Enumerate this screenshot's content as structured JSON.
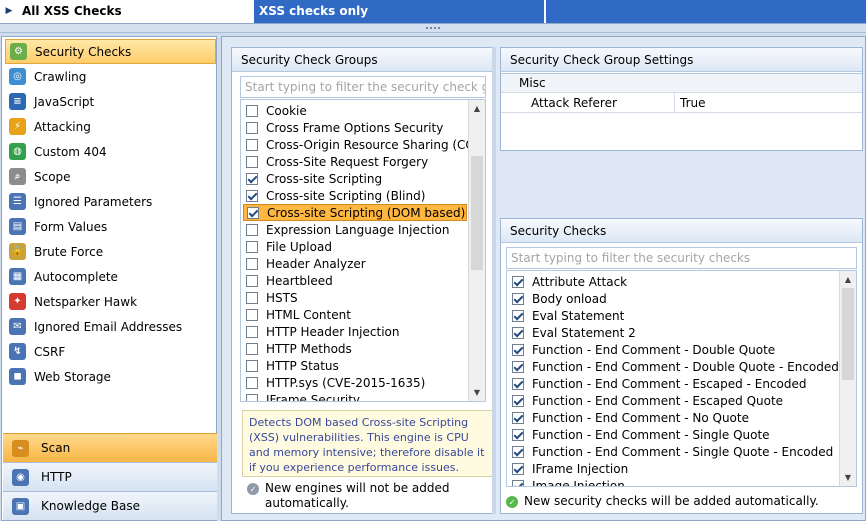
{
  "top": {
    "profile_name": "All XSS Checks",
    "profile_description": "XSS checks only"
  },
  "sidebar": {
    "items": [
      {
        "label": "Security Checks",
        "icon": "settings-icon",
        "active": true
      },
      {
        "label": "Crawling",
        "icon": "crawl-icon"
      },
      {
        "label": "JavaScript",
        "icon": "javascript-icon"
      },
      {
        "label": "Attacking",
        "icon": "lightning-icon"
      },
      {
        "label": "Custom 404",
        "icon": "globe-icon"
      },
      {
        "label": "Scope",
        "icon": "scope-icon"
      },
      {
        "label": "Ignored Parameters",
        "icon": "list-icon"
      },
      {
        "label": "Form Values",
        "icon": "form-icon"
      },
      {
        "label": "Brute Force",
        "icon": "lock-icon"
      },
      {
        "label": "Autocomplete",
        "icon": "grid-icon"
      },
      {
        "label": "Netsparker Hawk",
        "icon": "hawk-icon"
      },
      {
        "label": "Ignored Email Addresses",
        "icon": "email-icon"
      },
      {
        "label": "CSRF",
        "icon": "csrf-icon"
      },
      {
        "label": "Web Storage",
        "icon": "storage-icon"
      }
    ],
    "bottom_tabs": [
      {
        "label": "Scan",
        "icon": "scan-icon",
        "active": true
      },
      {
        "label": "HTTP",
        "icon": "http-icon"
      },
      {
        "label": "Knowledge Base",
        "icon": "book-icon"
      }
    ]
  },
  "groups": {
    "title": "Security Check Groups",
    "filter_placeholder": "Start typing to filter the security check groups",
    "items": [
      {
        "label": "Cookie",
        "checked": false
      },
      {
        "label": "Cross Frame Options Security",
        "checked": false
      },
      {
        "label": "Cross-Origin Resource Sharing (CORS)",
        "checked": false
      },
      {
        "label": "Cross-Site Request Forgery",
        "checked": false
      },
      {
        "label": "Cross-site Scripting",
        "checked": true
      },
      {
        "label": "Cross-site Scripting (Blind)",
        "checked": true
      },
      {
        "label": "Cross-site Scripting (DOM based)",
        "checked": true,
        "selected": true
      },
      {
        "label": "Expression Language Injection",
        "checked": false
      },
      {
        "label": "File Upload",
        "checked": false
      },
      {
        "label": "Header Analyzer",
        "checked": false
      },
      {
        "label": "Heartbleed",
        "checked": false
      },
      {
        "label": "HSTS",
        "checked": false
      },
      {
        "label": "HTML Content",
        "checked": false
      },
      {
        "label": "HTTP Header Injection",
        "checked": false
      },
      {
        "label": "HTTP Methods",
        "checked": false
      },
      {
        "label": "HTTP Status",
        "checked": false
      },
      {
        "label": "HTTP.sys (CVE-2015-1635)",
        "checked": false
      },
      {
        "label": "IFrame Security",
        "checked": false
      }
    ],
    "description": "Detects DOM based Cross-site Scripting (XSS) vulnerabilities. This engine is CPU and memory intensive; therefore disable it if you experience performance issues.",
    "note": "New engines will not be added automatically."
  },
  "group_settings": {
    "title": "Security Check Group Settings",
    "category": "Misc",
    "rows": [
      {
        "key": "Attack Referer",
        "value": "True"
      }
    ]
  },
  "checks": {
    "title": "Security Checks",
    "filter_placeholder": "Start typing to filter the security checks",
    "items": [
      {
        "label": "Attribute Attack",
        "checked": true
      },
      {
        "label": "Body onload",
        "checked": true
      },
      {
        "label": "Eval Statement",
        "checked": true
      },
      {
        "label": "Eval Statement 2",
        "checked": true
      },
      {
        "label": "Function - End Comment - Double Quote",
        "checked": true
      },
      {
        "label": "Function - End Comment - Double Quote - Encoded",
        "checked": true
      },
      {
        "label": "Function - End Comment - Escaped - Encoded",
        "checked": true
      },
      {
        "label": "Function - End Comment - Escaped Quote",
        "checked": true
      },
      {
        "label": "Function - End Comment - No Quote",
        "checked": true
      },
      {
        "label": "Function - End Comment - Single Quote",
        "checked": true
      },
      {
        "label": "Function - End Comment - Single Quote - Encoded",
        "checked": true
      },
      {
        "label": "IFrame Injection",
        "checked": true
      },
      {
        "label": "Image Injection",
        "checked": true
      }
    ],
    "note": "New security checks will be added automatically."
  },
  "colors": {
    "selection_blue": "#316ac5",
    "active_orange": "#ffcd6b",
    "description_text": "#38479a",
    "green_ok": "#55b84a"
  }
}
